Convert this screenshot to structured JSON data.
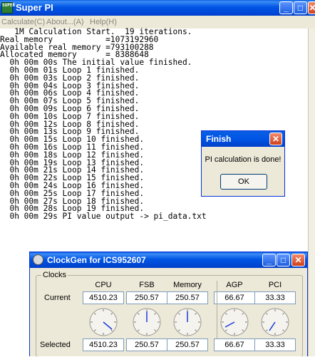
{
  "superpi": {
    "title": "Super PI",
    "icon_text": "SUPER",
    "menu": [
      "Calculate(C)",
      "About...(A)",
      "Help(H)"
    ],
    "console": [
      "   1M Calculation Start.  19 iterations.",
      "Real memory           =1073192960",
      "Available real memory =793100288",
      "Allocated memory      = 8388648",
      "  0h 00m 00s The initial value finished.",
      "  0h 00m 01s Loop 1 finished.",
      "  0h 00m 03s Loop 2 finished.",
      "  0h 00m 04s Loop 3 finished.",
      "  0h 00m 06s Loop 4 finished.",
      "  0h 00m 07s Loop 5 finished.",
      "  0h 00m 09s Loop 6 finished.",
      "  0h 00m 10s Loop 7 finished.",
      "  0h 00m 12s Loop 8 finished.",
      "  0h 00m 13s Loop 9 finished.",
      "  0h 00m 15s Loop 10 finished.",
      "  0h 00m 16s Loop 11 finished.",
      "  0h 00m 18s Loop 12 finished.",
      "  0h 00m 19s Loop 13 finished.",
      "  0h 00m 21s Loop 14 finished.",
      "  0h 00m 22s Loop 15 finished.",
      "  0h 00m 24s Loop 16 finished.",
      "  0h 00m 25s Loop 17 finished.",
      "  0h 00m 27s Loop 18 finished.",
      "  0h 00m 28s Loop 19 finished.",
      "  0h 00m 29s PI value output -> pi_data.txt"
    ]
  },
  "finish_dialog": {
    "title": "Finish",
    "message": "PI calculation is done!",
    "ok_label": "OK"
  },
  "clockgen": {
    "title": "ClockGen for ICS952607",
    "group_label": "Clocks",
    "row_labels": {
      "current": "Current",
      "selected": "Selected"
    },
    "columns": [
      {
        "name": "CPU",
        "current": "4510.23",
        "selected": "4510.23"
      },
      {
        "name": "FSB",
        "current": "250.57",
        "selected": "250.57"
      },
      {
        "name": "Memory",
        "current": "250.57",
        "selected": "250.57"
      },
      {
        "name": "AGP",
        "current": "66.67",
        "selected": "66.67"
      },
      {
        "name": "PCI",
        "current": "33.33",
        "selected": "33.33"
      }
    ]
  },
  "colors": {
    "titlebar": "#0055e5",
    "dialog_bg": "#ece9d8",
    "close_button": "#d1401c"
  }
}
